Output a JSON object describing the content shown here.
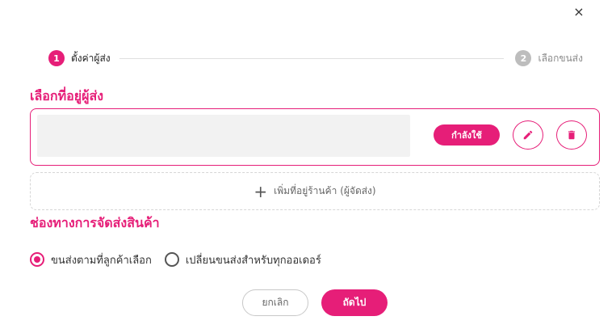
{
  "close_symbol": "×",
  "stepper": {
    "steps": [
      {
        "number": "1",
        "label": "ตั้งค่าผู้ส่ง",
        "state": "active"
      },
      {
        "number": "2",
        "label": "เลือกขนส่ง",
        "state": "inactive"
      }
    ]
  },
  "sender_section": {
    "title": "เลือกที่อยู่ผู้ส่ง",
    "address_card": {
      "status_badge": "กำลังใช้"
    },
    "add_address_icon": "+",
    "add_address_label": "เพิ่มที่อยู่ร้านค้า (ผู้จัดส่ง)"
  },
  "shipping_section": {
    "title": "ช่องทางการจัดส่งสินค้า",
    "options": [
      {
        "label": "ขนส่งตามที่ลูกค้าเลือก",
        "selected": true
      },
      {
        "label": "เปลี่ยนขนส่งสำหรับทุกออเดอร์",
        "selected": false
      }
    ]
  },
  "actions": {
    "cancel_label": "ยกเลิก",
    "next_label": "ถัดไป"
  },
  "icons": {
    "close": "close-icon",
    "edit": "pencil-icon",
    "delete": "trash-icon",
    "add": "plus-icon"
  },
  "colors": {
    "accent": "#e61e78",
    "inactive_step": "#bdbdbd",
    "placeholder": "#f2f2f2"
  }
}
